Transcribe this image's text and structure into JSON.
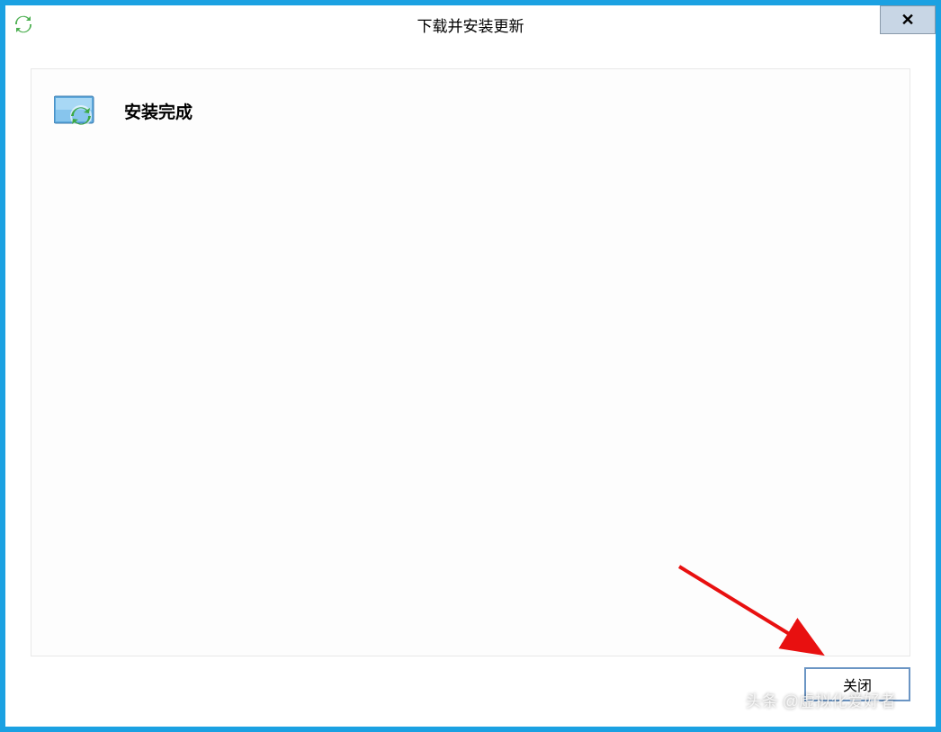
{
  "window": {
    "title": "下载并安装更新"
  },
  "content": {
    "status_heading": "安装完成"
  },
  "buttons": {
    "close_label": "关闭",
    "titlebar_close": "✕"
  },
  "watermark": {
    "text": "头条 @虚拟化爱好者"
  }
}
